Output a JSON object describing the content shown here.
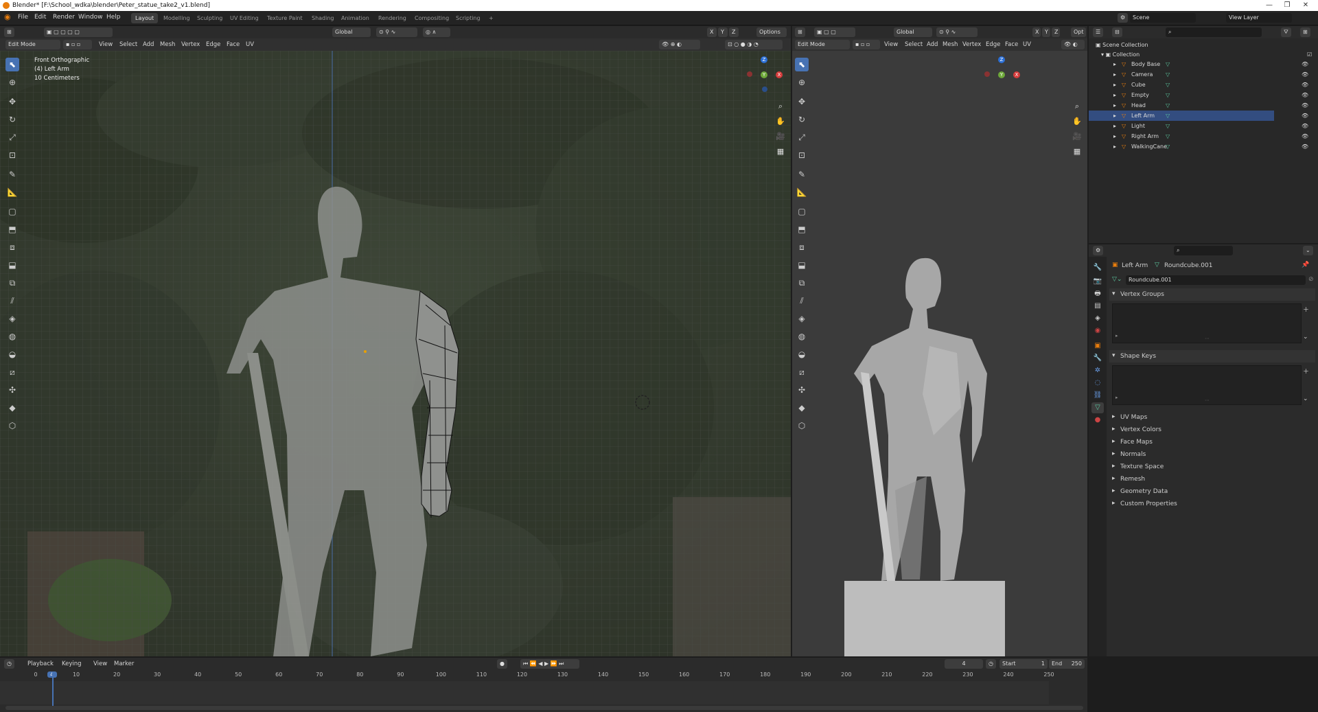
{
  "window": {
    "title": "Blender* [F:\\School_wdka\\blender\\Peter_statue_take2_v1.blend]",
    "min": "—",
    "max": "❐",
    "close": "✕"
  },
  "menubar": {
    "items": [
      "File",
      "Edit",
      "Render",
      "Window",
      "Help"
    ],
    "workspaces": [
      "Layout",
      "Modelling",
      "Sculpting",
      "UV Editing",
      "Texture Paint",
      "Shading",
      "Animation",
      "Rendering",
      "Compositing",
      "Scripting"
    ],
    "add_workspace": "+",
    "scene": "Scene",
    "view_layer": "View Layer"
  },
  "viewport_left": {
    "transform_orientation": "Global",
    "mode": "Edit Mode",
    "menus": [
      "View",
      "Select",
      "Add",
      "Mesh",
      "Vertex",
      "Edge",
      "Face",
      "UV"
    ],
    "axes": [
      "X",
      "Y",
      "Z"
    ],
    "options": "Options",
    "overlay_text": {
      "view": "Front Orthographic",
      "object": "(4) Left Arm",
      "scale": "10 Centimeters"
    },
    "gizmo": {
      "z": "Z",
      "x": "X",
      "y": "Y"
    }
  },
  "viewport_right": {
    "transform_orientation": "Global",
    "mode": "Edit Mode",
    "menus": [
      "View",
      "Select",
      "Add",
      "Mesh",
      "Vertex",
      "Edge",
      "Face",
      "UV"
    ],
    "axes": [
      "X",
      "Y",
      "Z"
    ],
    "options": "Opt",
    "gizmo": {
      "z": "Z",
      "x": "X",
      "y": "Y"
    }
  },
  "outliner": {
    "search_placeholder": "",
    "root": "Scene Collection",
    "collection": "Collection",
    "items": [
      {
        "name": "Body Base",
        "selected": false
      },
      {
        "name": "Camera",
        "selected": false
      },
      {
        "name": "Cube",
        "selected": false
      },
      {
        "name": "Empty",
        "selected": false
      },
      {
        "name": "Head",
        "selected": false
      },
      {
        "name": "Left Arm",
        "selected": true
      },
      {
        "name": "Light",
        "selected": false
      },
      {
        "name": "Right Arm",
        "selected": false
      },
      {
        "name": "WalkingCane",
        "selected": false
      }
    ]
  },
  "properties": {
    "object_name": "Left Arm",
    "mesh_name": "Roundcube.001",
    "datablock": "Roundcube.001",
    "panels": {
      "vertex_groups": "Vertex Groups",
      "shape_keys": "Shape Keys"
    },
    "collapsed": [
      "UV Maps",
      "Vertex Colors",
      "Face Maps",
      "Normals",
      "Texture Space",
      "Remesh",
      "Geometry Data",
      "Custom Properties"
    ]
  },
  "timeline": {
    "menus": [
      "Playback",
      "Keying",
      "View",
      "Marker"
    ],
    "current_frame": "4",
    "start_label": "Start",
    "start": "1",
    "end_label": "End",
    "end": "250",
    "ticks": [
      "0",
      "4",
      "10",
      "20",
      "30",
      "40",
      "50",
      "60",
      "70",
      "80",
      "90",
      "100",
      "110",
      "120",
      "130",
      "140",
      "150",
      "160",
      "170",
      "180",
      "190",
      "200",
      "210",
      "220",
      "230",
      "240",
      "250"
    ]
  },
  "colors": {
    "accent": "#4772b3",
    "selected_row": "#334d80",
    "mesh_icon": "#e87d0d",
    "data_icon": "#5cc8a0"
  }
}
